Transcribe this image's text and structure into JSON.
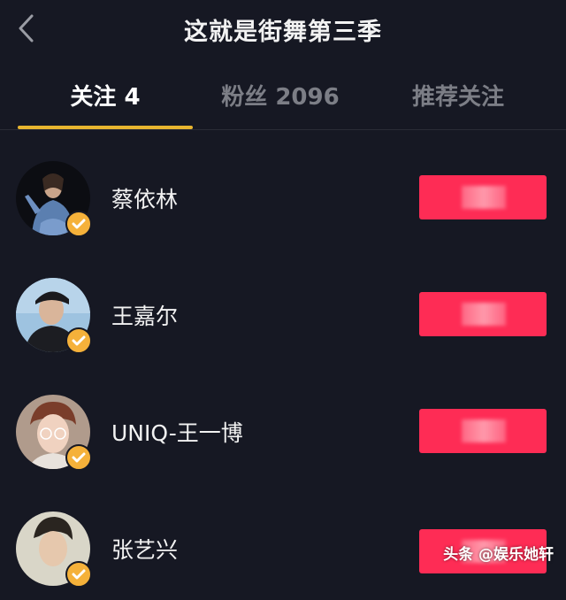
{
  "header": {
    "title": "这就是街舞第三季",
    "back_icon": "chevron-left-icon"
  },
  "tabs": [
    {
      "label": "关注 4",
      "active": true
    },
    {
      "label": "粉丝 2096",
      "active": false
    },
    {
      "label": "推荐关注",
      "active": false
    }
  ],
  "colors": {
    "background": "#161823",
    "accent_underline": "#e8b52f",
    "follow_button": "#fe2c55",
    "verified_badge": "#f5b13a"
  },
  "users": [
    {
      "name": "蔡依林",
      "verified": true
    },
    {
      "name": "王嘉尔",
      "verified": true
    },
    {
      "name": "UNIQ-王一博",
      "verified": true
    },
    {
      "name": "张艺兴",
      "verified": true
    }
  ],
  "watermark": "头条 @娱乐她轩"
}
